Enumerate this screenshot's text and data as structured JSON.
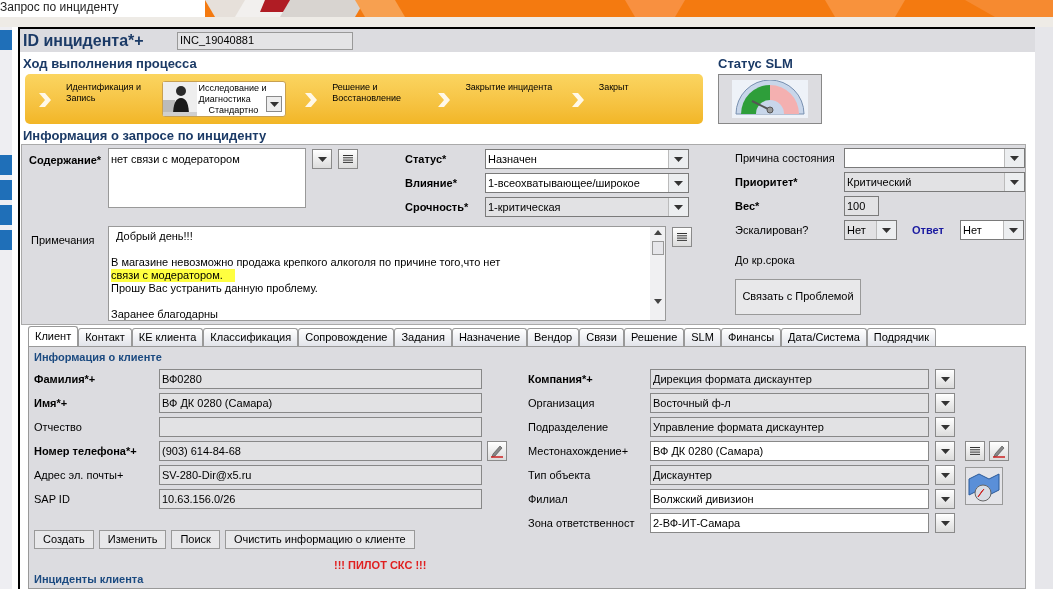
{
  "window": {
    "title": "Запрос по инциденту"
  },
  "incident_id": {
    "label": "ID инцидента*+",
    "value": "INC_19040881"
  },
  "process": {
    "title": "Ход выполнения процесса",
    "stages": [
      {
        "label": "Идентификация и Запись",
        "selected": false
      },
      {
        "label": "Исследование и Диагностика",
        "selected": true,
        "mode": "Стандартно"
      },
      {
        "label": "Решение и Восстановление",
        "selected": false
      },
      {
        "label": "Закрытие инцидента",
        "selected": false
      },
      {
        "label": "Закрыт",
        "selected": false
      }
    ]
  },
  "slm": {
    "title": "Статус SLM"
  },
  "request_info": {
    "title": "Информация о запросе по инциденту",
    "summary": {
      "label": "Содержание*",
      "value": "нет связи с модератором"
    },
    "notes": {
      "label": "Примечания",
      "paragraphs": [
        [
          {
            "text": "Добрый день!!!",
            "highlighted": false
          }
        ],
        [
          {
            "text": "В магазине невозможно продажа крепкого алкоголя по причине того,что нет",
            "highlighted": false
          },
          {
            "text": "связи с модератором.",
            "highlighted": true
          },
          {
            "text": "Прошу Вас устранить данную проблему.",
            "highlighted": false
          }
        ],
        [
          {
            "text": "Заранее благодарны",
            "highlighted": false
          }
        ]
      ]
    },
    "status_fields": [
      {
        "label": "Статус*",
        "value": "Назначен",
        "required": true,
        "read_only": false
      },
      {
        "label": "Влияние*",
        "value": "1-всеохватывающее/широкое",
        "required": true,
        "read_only": false
      },
      {
        "label": "Срочность*",
        "value": "1-критическая",
        "required": true,
        "read_only": true
      }
    ],
    "side_fields": [
      {
        "kind": "select",
        "label": "Причина состояния",
        "required": false,
        "read_only": false
      },
      {
        "kind": "select",
        "label": "Приоритет*",
        "value": "Критический",
        "required": true,
        "read_only": true
      },
      {
        "kind": "text",
        "label": "Вес*",
        "value": "100",
        "required": true,
        "read_only": true
      }
    ],
    "escalated": {
      "label": "Эскалирован?",
      "value": "Нет"
    },
    "answer": {
      "label": "Ответ",
      "value": "Нет"
    },
    "deadline": {
      "label": "До кр.срока"
    },
    "link_button": "Связать с Проблемой"
  },
  "tabs": [
    {
      "label": "Клиент",
      "selected": true
    },
    {
      "label": "Контакт",
      "selected": false
    },
    {
      "label": "КЕ клиента",
      "selected": false
    },
    {
      "label": "Классификация",
      "selected": false
    },
    {
      "label": "Сопровождение",
      "selected": false
    },
    {
      "label": "Задания",
      "selected": false
    },
    {
      "label": "Назначение",
      "selected": false
    },
    {
      "label": "Вендор",
      "selected": false
    },
    {
      "label": "Связи",
      "selected": false
    },
    {
      "label": "Решение",
      "selected": false
    },
    {
      "label": "SLM",
      "selected": false
    },
    {
      "label": "Финансы",
      "selected": false
    },
    {
      "label": "Дата/Система",
      "selected": false
    },
    {
      "label": "Подрядчик",
      "selected": false
    }
  ],
  "client": {
    "title": "Информация о клиенте",
    "left_fields": [
      {
        "kind": "text",
        "label": "Фамилия*+",
        "value": "ВФ0280",
        "required": true
      },
      {
        "kind": "text",
        "label": "Имя*+",
        "value": "ВФ ДК 0280 (Самара)",
        "required": true
      },
      {
        "kind": "text",
        "label": "Отчество",
        "required": false
      },
      {
        "kind": "text_edit",
        "label": "Номер телефона*+",
        "value": "(903) 614-84-68",
        "required": true
      },
      {
        "kind": "text",
        "label": "Адрес эл. почты+",
        "value": "SV-280-Dir@x5.ru",
        "required": false
      },
      {
        "kind": "text",
        "label": "SAP ID",
        "value": "10.63.156.0/26",
        "required": false
      }
    ],
    "right_fields": [
      {
        "kind": "select",
        "label": "Компания*+",
        "value": "Дирекция формата дискаунтер",
        "required": true,
        "read_only": true
      },
      {
        "kind": "select",
        "label": "Организация",
        "value": "Восточный ф-л",
        "required": false,
        "read_only": true
      },
      {
        "kind": "select",
        "label": "Подразделение",
        "value": "Управление формата дискаунтер",
        "required": false,
        "read_only": true
      },
      {
        "kind": "select_tools",
        "label": "Местонахождение+",
        "value": "ВФ ДК 0280 (Самара)",
        "required": false,
        "read_only": false
      },
      {
        "kind": "select_map",
        "label": "Тип объекта",
        "value": "Дискаунтер",
        "required": false,
        "read_only": true
      },
      {
        "kind": "select",
        "label": "Филиал",
        "value": "Волжский дивизион",
        "required": false,
        "read_only": false
      },
      {
        "kind": "select",
        "label": "Зона ответственност",
        "value": "2-ВФ-ИТ-Самара",
        "required": false,
        "read_only": false
      }
    ],
    "buttons": [
      "Создать",
      "Изменить",
      "Поиск",
      "Очистить информацию о клиенте"
    ],
    "pilot_notice": "!!! ПИЛОТ СКС !!!",
    "incidents_title": "Инциденты клиента"
  }
}
